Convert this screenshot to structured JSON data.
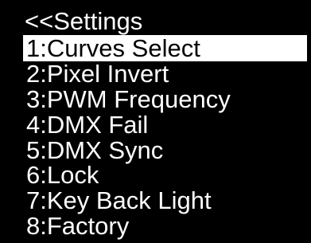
{
  "screen": {
    "title": "<<Settings",
    "items": [
      {
        "label": "1:Curves Select",
        "selected": true
      },
      {
        "label": "2:Pixel Invert",
        "selected": false
      },
      {
        "label": "3:PWM Frequency",
        "selected": false
      },
      {
        "label": "4:DMX Fail",
        "selected": false
      },
      {
        "label": "5:DMX Sync",
        "selected": false
      },
      {
        "label": "6:Lock",
        "selected": false
      },
      {
        "label": "7:Key Back Light",
        "selected": false
      },
      {
        "label": "8:Factory",
        "selected": false
      }
    ]
  },
  "colors": {
    "background": "#000000",
    "text": "#ffffff",
    "highlight": "#ffffff",
    "highlight_text": "#000000"
  }
}
